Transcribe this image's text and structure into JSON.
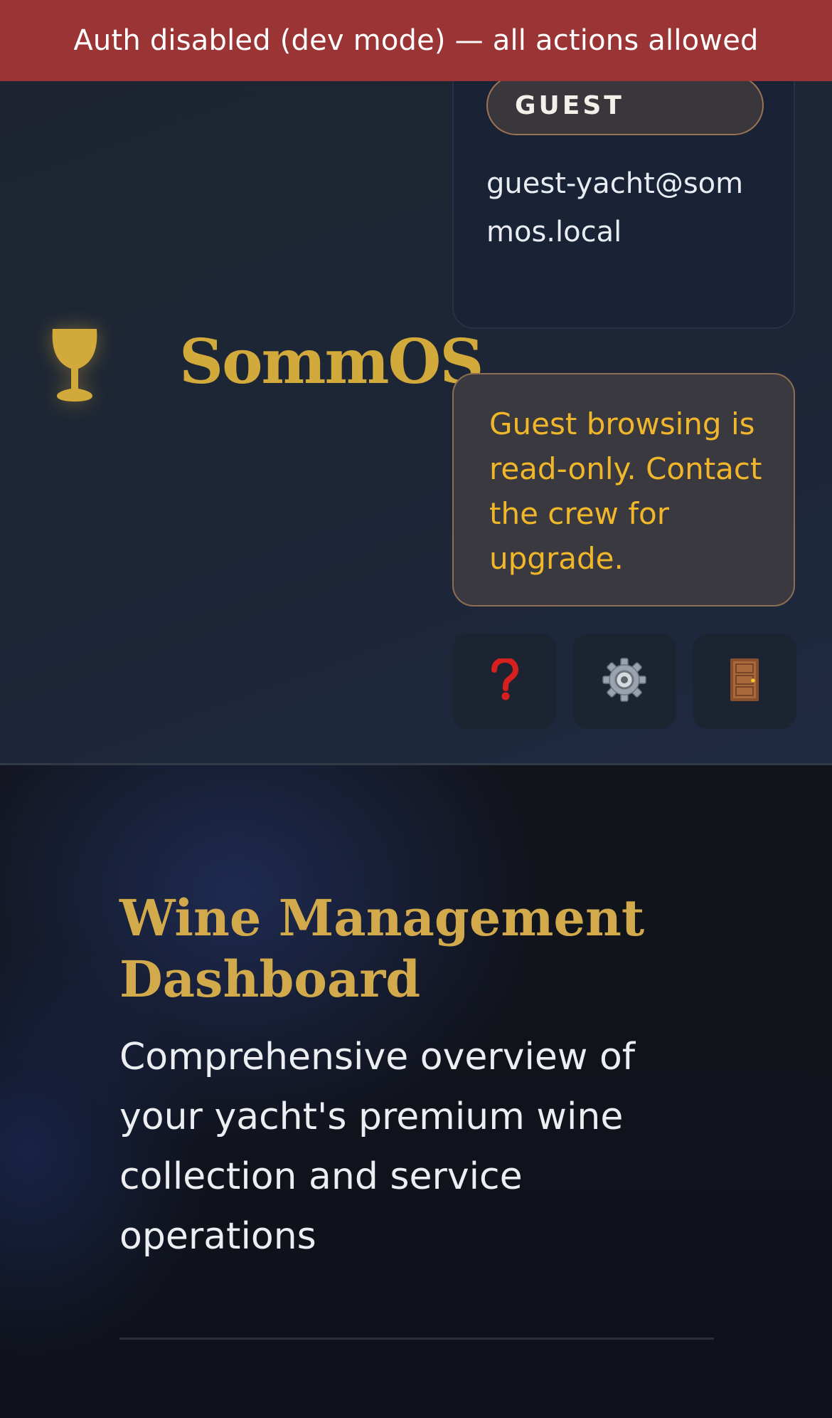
{
  "dev_banner": {
    "text": "Auth disabled (dev mode) — all actions allowed"
  },
  "header": {
    "brand": {
      "title": "SommOS",
      "icon": "wine-glass-icon"
    },
    "user": {
      "role": "GUEST",
      "email": "guest-yacht@sommos.local"
    },
    "notice": "Guest browsing is read-only. Contact the crew for upgrade.",
    "actions": [
      {
        "name": "help",
        "icon": "question-mark-icon"
      },
      {
        "name": "settings",
        "icon": "gear-icon"
      },
      {
        "name": "logout",
        "icon": "door-icon"
      }
    ]
  },
  "hero": {
    "title": "Wine Management Dashboard",
    "subtitle": "Comprehensive overview of your yacht's premium wine collection and service operations"
  },
  "colors": {
    "banner": "#9b3535",
    "accent_gold": "#d2aa3c",
    "notice_text": "#f1b72a",
    "pill_border": "#9a7355"
  }
}
